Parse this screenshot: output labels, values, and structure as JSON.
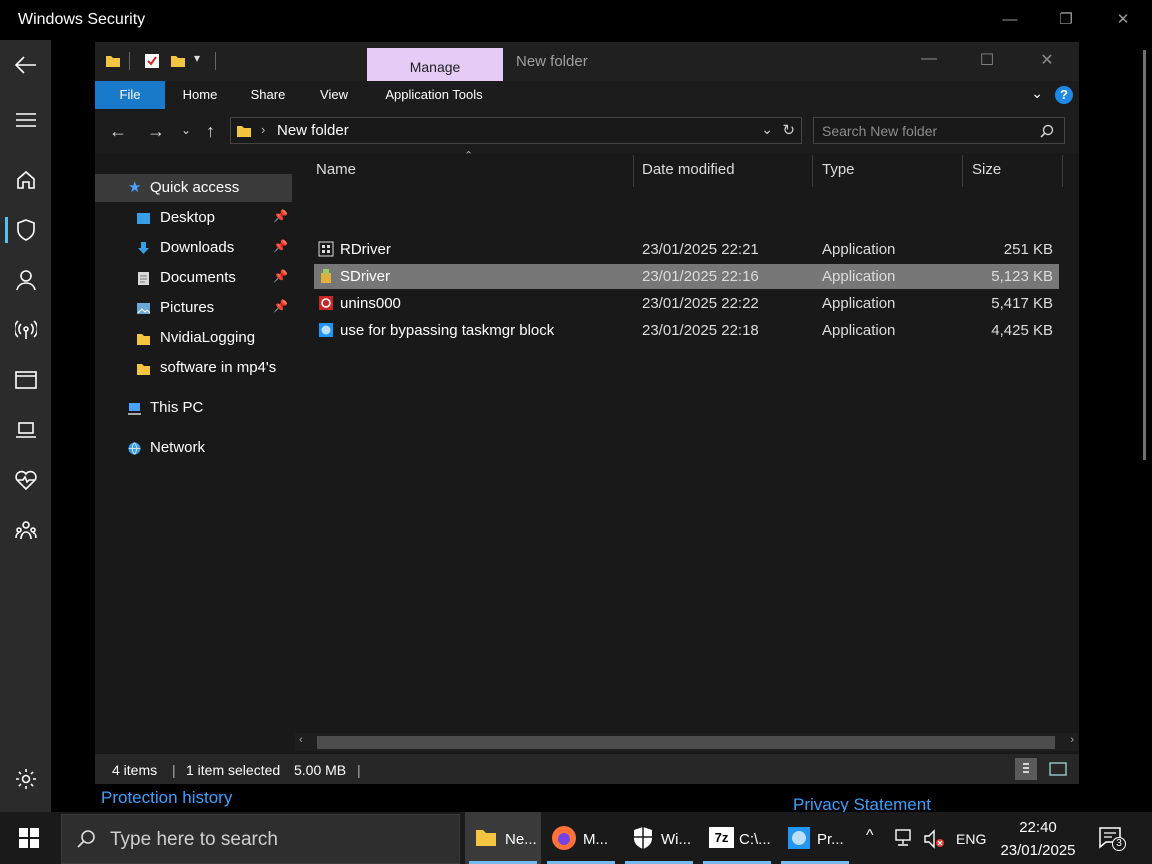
{
  "security": {
    "title": "Windows Security",
    "protection_history": "Protection history",
    "privacy_statement": "Privacy Statement"
  },
  "explorer": {
    "manage_tab": "Manage",
    "window_title": "New folder",
    "ribbon": {
      "file": "File",
      "home": "Home",
      "share": "Share",
      "view": "View",
      "app_tools": "Application Tools"
    },
    "address": "New folder",
    "search_placeholder": "Search New folder",
    "nav": {
      "quick_access": "Quick access",
      "items": [
        {
          "label": "Desktop",
          "pinned": true
        },
        {
          "label": "Downloads",
          "pinned": true
        },
        {
          "label": "Documents",
          "pinned": true
        },
        {
          "label": "Pictures",
          "pinned": true
        },
        {
          "label": "NvidiaLogging",
          "pinned": false
        },
        {
          "label": "software in mp4's",
          "pinned": false
        }
      ],
      "this_pc": "This PC",
      "network": "Network"
    },
    "columns": {
      "name": "Name",
      "date": "Date modified",
      "type": "Type",
      "size": "Size"
    },
    "files": [
      {
        "name": "RDriver",
        "date": "23/01/2025 22:21",
        "type": "Application",
        "size": "251 KB"
      },
      {
        "name": "SDriver",
        "date": "23/01/2025 22:16",
        "type": "Application",
        "size": "5,123 KB"
      },
      {
        "name": "unins000",
        "date": "23/01/2025 22:22",
        "type": "Application",
        "size": "5,417 KB"
      },
      {
        "name": "use for bypassing taskmgr block",
        "date": "23/01/2025 22:18",
        "type": "Application",
        "size": "4,425 KB"
      }
    ],
    "status": {
      "items": "4 items",
      "selected": "1 item selected",
      "size": "5.00 MB"
    }
  },
  "taskbar": {
    "search_placeholder": "Type here to search",
    "apps": [
      {
        "label": "Ne..."
      },
      {
        "label": "M..."
      },
      {
        "label": "Wi..."
      },
      {
        "label": "C:\\..."
      },
      {
        "label": "Pr..."
      }
    ],
    "lang": "ENG",
    "time": "22:40",
    "date": "23/01/2025",
    "notifications": "3"
  },
  "colors": {
    "accent": "#1979ca",
    "manage_tab": "#e6cbf7",
    "link": "#3aa0ff",
    "folder": "#f5c542"
  }
}
